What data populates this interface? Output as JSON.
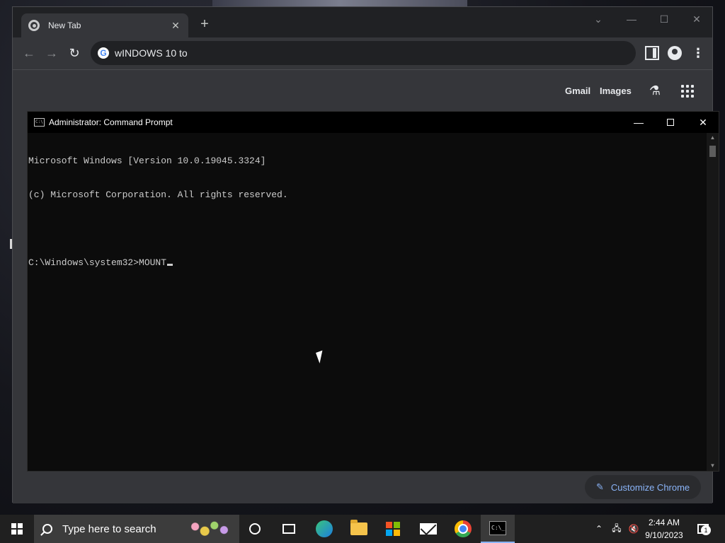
{
  "chrome": {
    "tab_title": "New Tab",
    "address_text": "wINDOWS 10 to",
    "gmail_label": "Gmail",
    "images_label": "Images",
    "customize_label": "Customize Chrome"
  },
  "cmd": {
    "title": "Administrator: Command Prompt",
    "lines": [
      "Microsoft Windows [Version 10.0.19045.3324]",
      "(c) Microsoft Corporation. All rights reserved.",
      "",
      "C:\\Windows\\system32>MOUNT"
    ]
  },
  "taskbar": {
    "search_placeholder": "Type here to search",
    "time": "2:44 AM",
    "date": "9/10/2023",
    "notification_count": "1"
  },
  "icons": {
    "chrome_tab": "chrome-favicon-icon",
    "tab_close": "close-icon",
    "new_tab": "plus-icon",
    "back": "arrow-left-icon",
    "forward": "arrow-right-icon",
    "reload": "reload-icon",
    "google": "google-g-icon",
    "side_panel": "side-panel-icon",
    "profile": "profile-icon",
    "menu": "kebab-menu-icon",
    "labs": "flask-icon",
    "apps": "apps-grid-icon",
    "pencil": "pencil-icon",
    "start": "windows-logo-icon",
    "search": "search-icon",
    "cortana": "cortana-icon",
    "task_view": "task-view-icon",
    "edge": "edge-icon",
    "explorer": "folder-icon",
    "store": "store-icon",
    "mail": "mail-icon",
    "chrome": "chrome-icon",
    "terminal": "cmd-icon",
    "chevron_up": "chevron-up-icon",
    "network": "network-icon",
    "volume": "volume-muted-icon",
    "notifications": "notifications-icon"
  },
  "colors": {
    "cmd_background": "#0c0c0c",
    "cmd_text": "#cccccc",
    "chrome_dark": "#35363a",
    "accent_link": "#8ab4f8",
    "taskbar": "#202020"
  }
}
